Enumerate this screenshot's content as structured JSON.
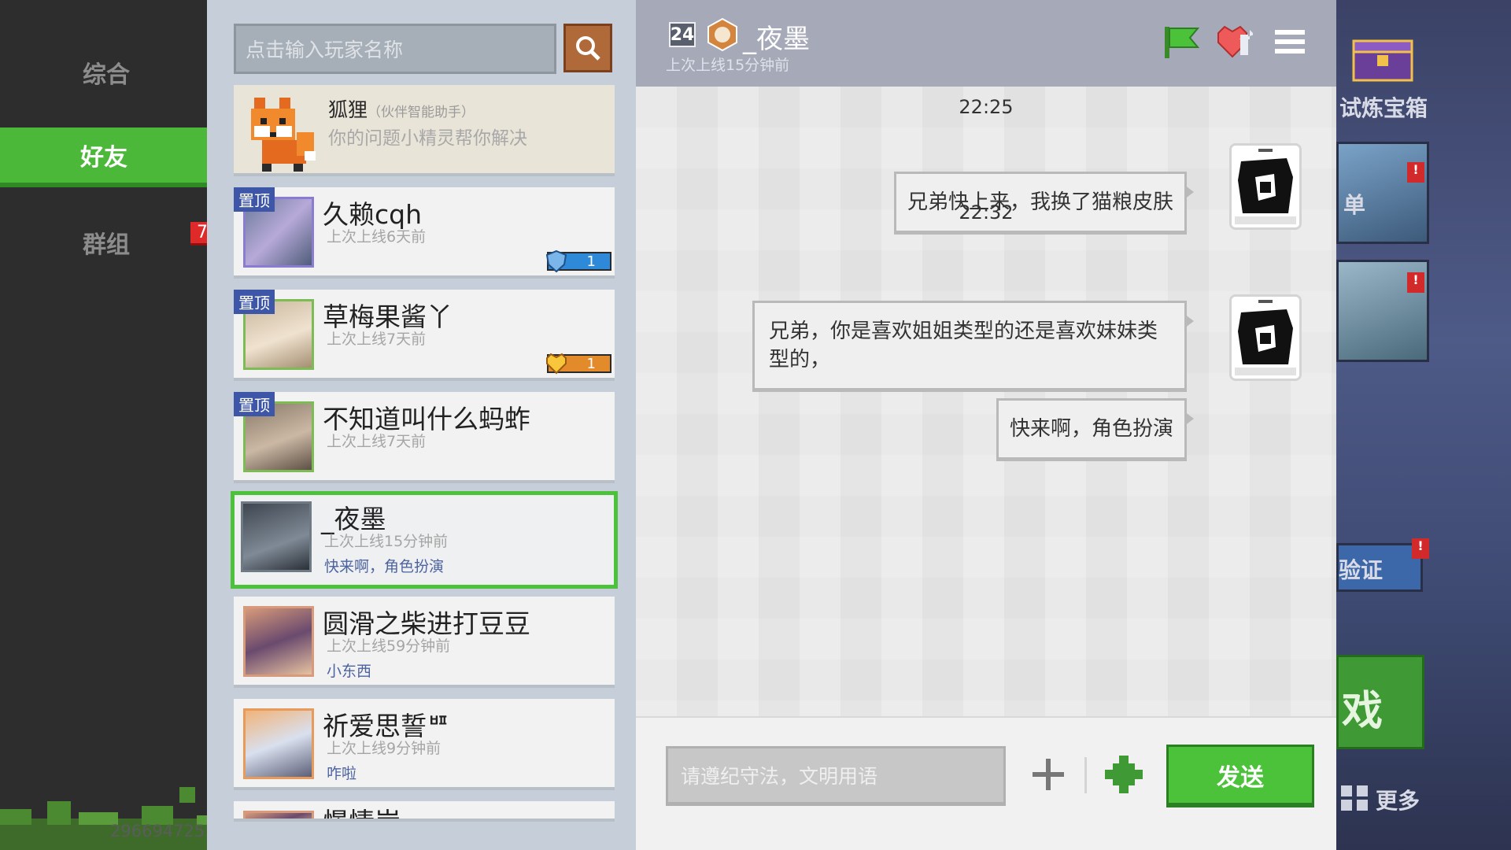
{
  "nav": {
    "items": [
      {
        "label": "综合"
      },
      {
        "label": "好友"
      },
      {
        "label": "群组"
      }
    ],
    "group_badge": "7",
    "player_id": "2966947255"
  },
  "search": {
    "placeholder": "点击输入玩家名称"
  },
  "ai_card": {
    "name": "狐狸",
    "tag": "（伙伴智能助手）",
    "desc": "你的问题小精灵帮你解决"
  },
  "friends": [
    {
      "pin": "置顶",
      "name": "久赖cqh",
      "status": "上次上线6天前",
      "preview": "",
      "level": "1"
    },
    {
      "pin": "置顶",
      "name": "草梅果酱丫",
      "status": "上次上线7天前",
      "preview": "",
      "level": "1"
    },
    {
      "pin": "置顶",
      "name": "不知道叫什么蚂蚱",
      "status": "上次上线7天前",
      "preview": ""
    },
    {
      "pin": "",
      "name": "_夜墨",
      "status": "上次上线15分钟前",
      "preview": "快来啊，角色扮演"
    },
    {
      "pin": "",
      "name": "圆滑之柴进打豆豆",
      "status": "上次上线59分钟前",
      "preview": "小东西"
    },
    {
      "pin": "",
      "name": "祈爱思誓ᄪ",
      "status": "上次上线9分钟前",
      "preview": "咋啦"
    },
    {
      "pin": "",
      "name": "憬情岸",
      "status": "",
      "preview": ""
    }
  ],
  "chat": {
    "level": "24",
    "medal": "1",
    "name": "_夜墨",
    "status": "上次上线15分钟前",
    "messages": [
      {
        "time": "22:25",
        "text": "兄弟快上来，我换了猫粮皮肤"
      },
      {
        "time": "22:32",
        "text": "兄弟，你是喜欢姐姐类型的还是喜欢妹妹类型的，"
      },
      {
        "time": "",
        "text": "快来啊，角色扮演"
      }
    ],
    "input_placeholder": "请遵纪守法，文明用语",
    "send_label": "发送"
  },
  "right_strip": {
    "treasure_label": "试炼宝箱",
    "list_label": "单",
    "verify_label": "验证",
    "game_label": "戏",
    "more_label": "更多"
  },
  "colors": {
    "accent_green": "#4cb83a",
    "pin_blue": "#3d56a8",
    "badge_red": "#e02a2a"
  }
}
